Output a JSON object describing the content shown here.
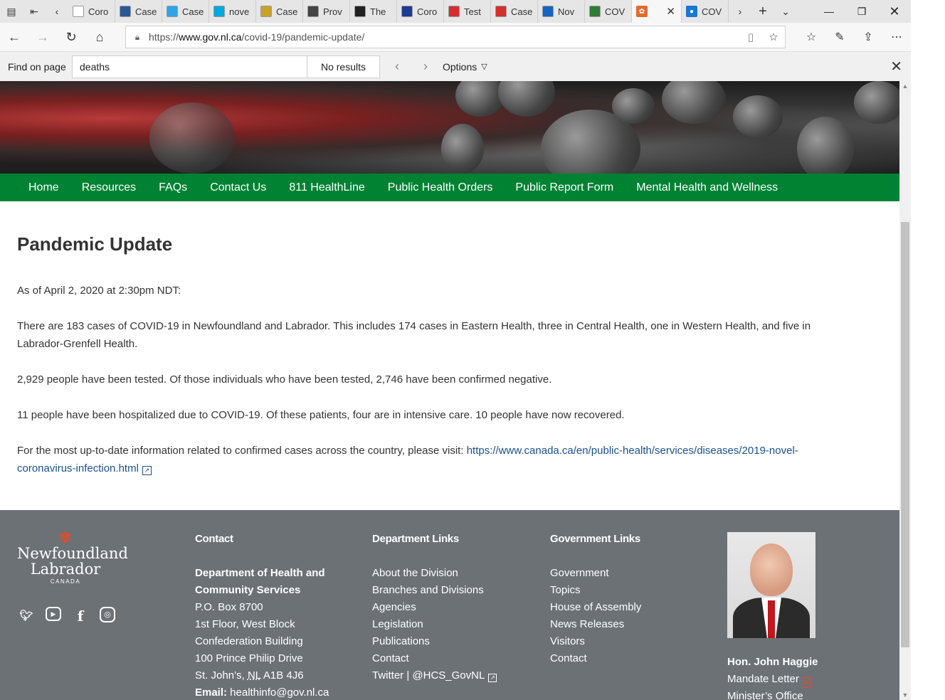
{
  "browser": {
    "tabs": [
      {
        "title": "Coro",
        "color": "#ffffff"
      },
      {
        "title": "Case",
        "color": "#2b5797"
      },
      {
        "title": "Case",
        "color": "#2fa4e7"
      },
      {
        "title": "nove",
        "color": "#00a8e0"
      },
      {
        "title": "Case",
        "color": "#c9a227"
      },
      {
        "title": "Prov",
        "color": "#444444"
      },
      {
        "title": "The",
        "color": "#222222"
      },
      {
        "title": "Coro",
        "color": "#1f3a93"
      },
      {
        "title": "Test",
        "color": "#d32f2f"
      },
      {
        "title": "Case",
        "color": "#d32f2f"
      },
      {
        "title": "Nov",
        "color": "#1565c0"
      },
      {
        "title": "COV",
        "color": "#2e7d32"
      }
    ],
    "active_tab": {
      "title": "",
      "color": "#e36a2e"
    },
    "after_active_tab": {
      "title": "COV",
      "color": "#1976d2"
    },
    "url_prefix": "https://",
    "url_host": "www.gov.nl.ca",
    "url_path": "/covid-19/pandemic-update/"
  },
  "find": {
    "label": "Find on page",
    "query": "deaths",
    "status": "No results",
    "options_label": "Options"
  },
  "site": {
    "nav": [
      "Home",
      "Resources",
      "FAQs",
      "Contact Us",
      "811 HealthLine",
      "Public Health Orders",
      "Public Report Form",
      "Mental Health and Wellness"
    ]
  },
  "content": {
    "title": "Pandemic Update",
    "para1": "As of April 2, 2020 at 2:30pm NDT:",
    "para2": "There are 183 cases of COVID-19 in Newfoundland and Labrador. This includes 174 cases in Eastern Health, three in Central Health, one in Western Health, and five in Labrador-Grenfell Health.",
    "para3": "2,929 people have been tested. Of those individuals who have been tested, 2,746 have been confirmed negative.",
    "para4": "11 people have been hospitalized due to COVID-19. Of these patients, four are in intensive care. 10 people have now recovered.",
    "para5_text": "For the most up-to-date information related to confirmed cases across the country, please visit: ",
    "para5_link": "https://www.canada.ca/en/public-health/services/diseases/2019-novel-coronavirus-infection.html"
  },
  "footer": {
    "logo": {
      "line1": "Newfoundland",
      "line2": "Labrador",
      "line3": "CANADA"
    },
    "contact": {
      "heading": "Contact",
      "dept_line1": "Department of Health and",
      "dept_line2": "Community Services",
      "lines": [
        "P.O. Box 8700",
        "1st Floor, West Block",
        "Confederation Building",
        "100 Prince Philip Drive"
      ],
      "city_pre": "St. John’s, ",
      "city_prov": "NL",
      "city_post": " A1B 4J6",
      "email_label": "Email:",
      "email": " healthinfo@gov.nl.ca"
    },
    "dept_links": {
      "heading": "Department Links",
      "items": [
        "About the Division",
        "Branches and Divisions",
        "Agencies",
        "Legislation",
        "Publications",
        "Contact"
      ],
      "twitter": "Twitter | @HCS_GovNL"
    },
    "gov_links": {
      "heading": "Government Links",
      "items": [
        "Government",
        "Topics",
        "House of Assembly",
        "News Releases",
        "Visitors",
        "Contact"
      ]
    },
    "minister": {
      "name": "Hon. John Haggie",
      "mandate": "Mandate Letter",
      "office": "Minister’s Office"
    }
  }
}
